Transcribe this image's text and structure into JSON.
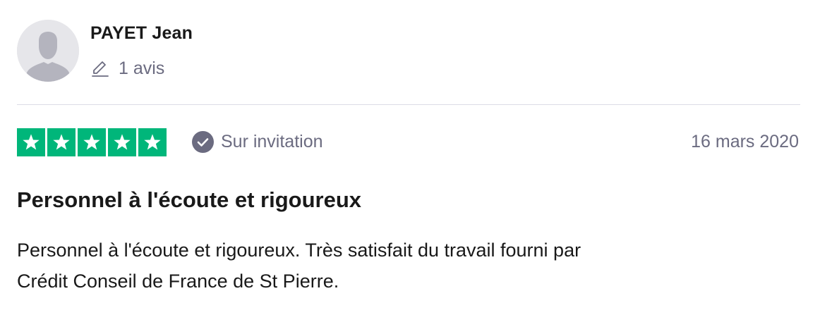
{
  "reviewer": {
    "avatar_icon": "user-silhouette-icon",
    "name": "PAYET Jean",
    "review_count_icon": "pencil-icon",
    "review_count_label": "1 avis"
  },
  "review": {
    "rating": 5,
    "max_rating": 5,
    "star_color": "#00b67a",
    "verification_icon": "check-circle-icon",
    "verification_label": "Sur invitation",
    "date": "16 mars 2020",
    "title": "Personnel à l'écoute et rigoureux",
    "body_lines": [
      "Personnel à l'écoute et rigoureux. Très satisfait du travail fourni par",
      "Crédit Conseil de France de St Pierre."
    ]
  }
}
